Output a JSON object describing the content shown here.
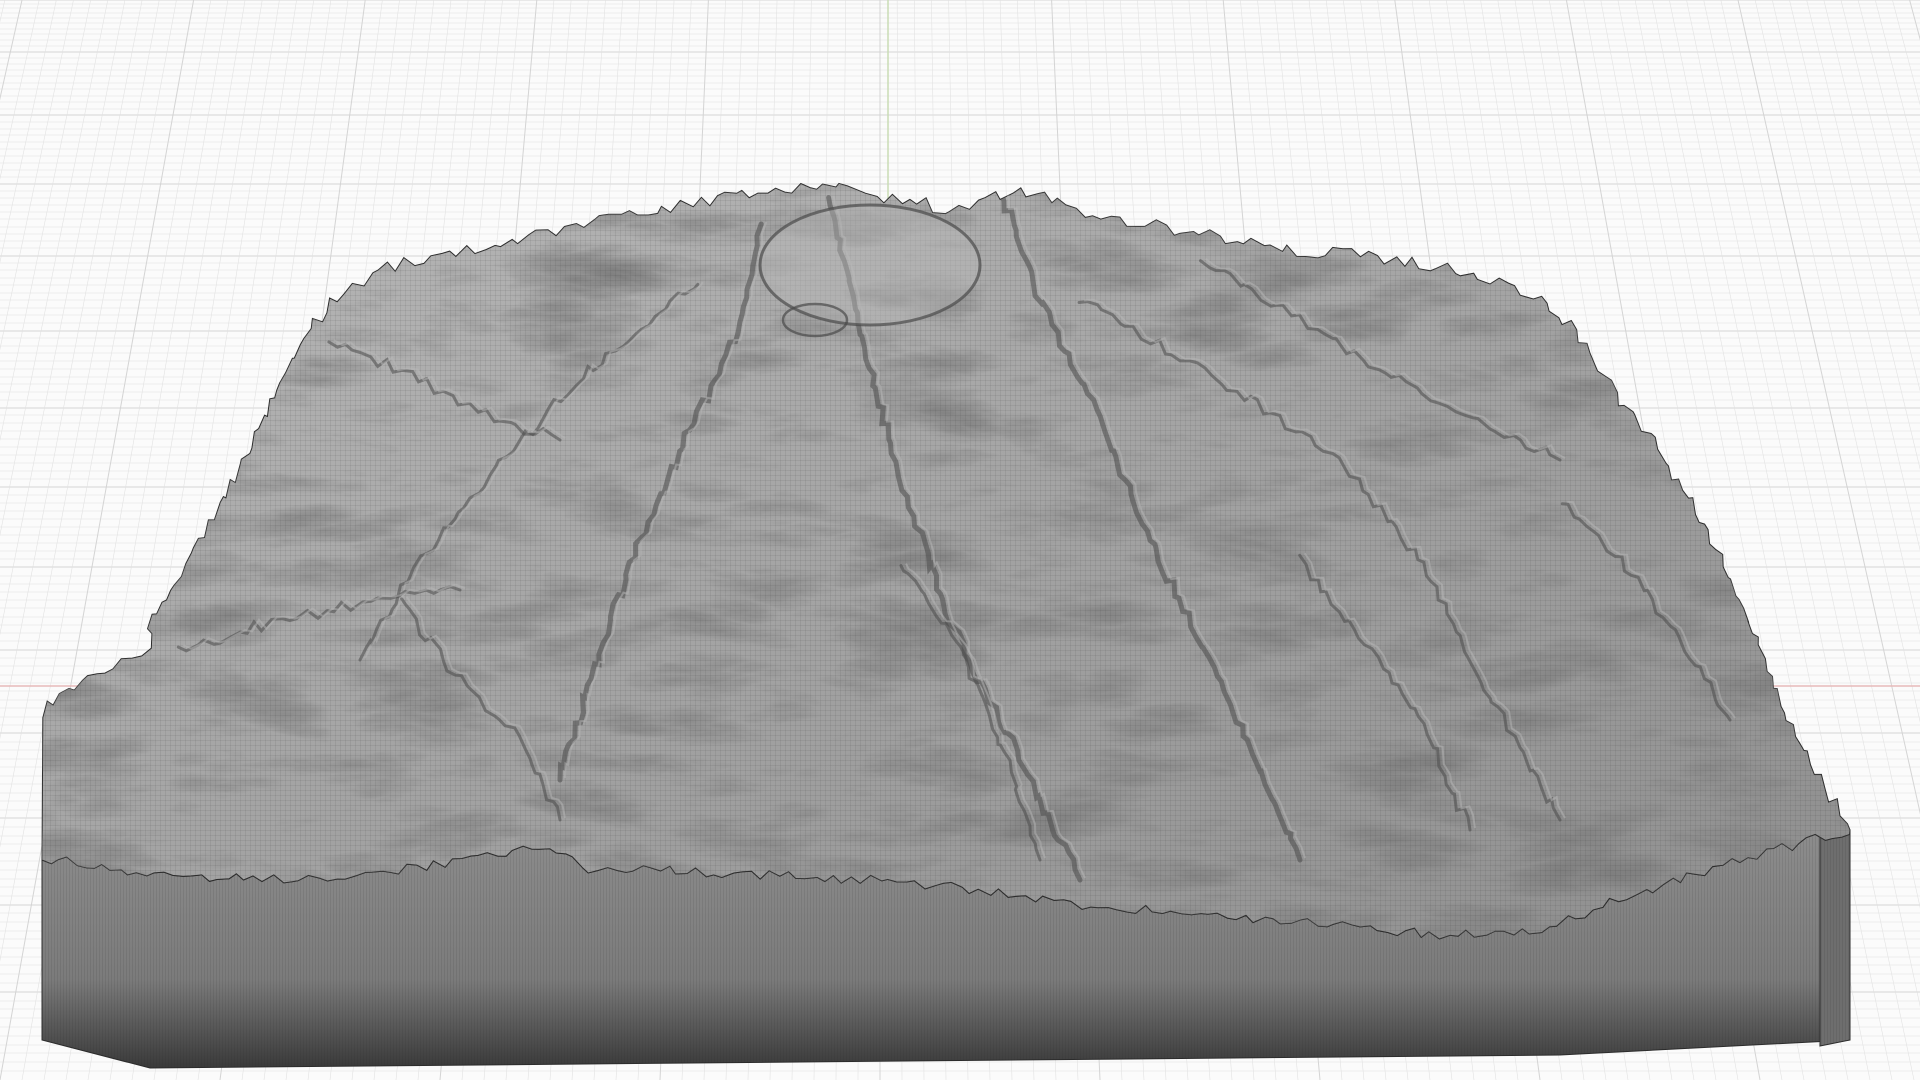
{
  "viewport": {
    "type": "3d-modeling-viewport",
    "projection": "perspective",
    "grid": true,
    "axes": [
      "x-axis",
      "y-axis"
    ],
    "object": "terrain-mesh",
    "render_mode": "shaded-with-wireframe"
  },
  "colors": {
    "background": "#fbfbfb",
    "grid_line": "#e2e2e2",
    "grid_major": "#d4d4d4",
    "x_axis": "#e7b9b9",
    "y_axis": "#c9dcb5",
    "terrain_top": "#8e8e8e",
    "terrain_shadow": "#4a4a4a",
    "terrain_highlight": "#b8b8b8",
    "wall_top": "#8c8c8c",
    "wall_bottom": "#3a3a3a",
    "wire": "#2c2c2c"
  }
}
